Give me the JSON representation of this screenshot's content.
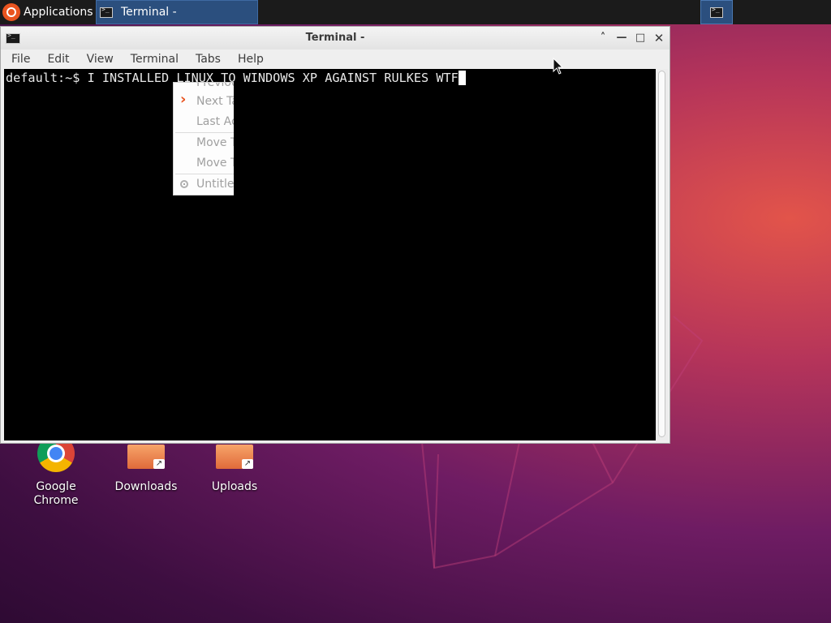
{
  "top_panel": {
    "applications_label": "Applications",
    "applications_separator": "≡",
    "taskbar_terminal_label": "Terminal -"
  },
  "window": {
    "title": "Terminal -",
    "controls": {
      "shade": "˄",
      "minimize": "—",
      "maximize": "□",
      "close": "✕"
    },
    "menu": [
      "File",
      "Edit",
      "View",
      "Terminal",
      "Tabs",
      "Help"
    ]
  },
  "terminal": {
    "prompt": "default:~$ ",
    "command": "I INSTALLED LINUX TO WINDOWS XP AGAINST RULKES WTF"
  },
  "context_menu": {
    "items": [
      {
        "label": "Previous Tab",
        "enabled": false,
        "icon": "chevron-left-icon"
      },
      {
        "label": "Next Tab",
        "enabled": false,
        "icon": "chevron-right-icon"
      },
      {
        "label": "Last Active Tab",
        "enabled": false
      },
      {
        "label": "Move Tab Left",
        "enabled": false
      },
      {
        "label": "Move Tab Right",
        "enabled": false
      },
      {
        "label": "Untitled",
        "enabled": false,
        "icon": "radio-selected-icon"
      }
    ]
  },
  "desktop_icons": [
    {
      "label": "Google Chrome",
      "icon": "chrome-icon"
    },
    {
      "label": "Downloads",
      "icon": "folder-link-icon"
    },
    {
      "label": "Uploads",
      "icon": "folder-link-icon"
    }
  ],
  "colors": {
    "accent": "#e95420",
    "taskbar_active": "#2b4f7e",
    "terminal_bg": "#000000"
  }
}
